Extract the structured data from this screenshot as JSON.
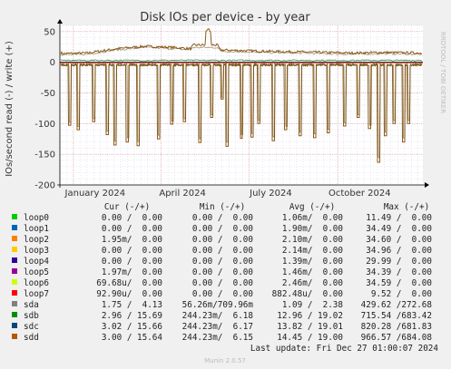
{
  "chart_data": {
    "type": "line",
    "title": "Disk IOs per device - by year",
    "ylabel": "IOs/second read (-) / write (+)",
    "watermark": "RRDTOOL / TOBI OETIKER",
    "ylim": [
      -200,
      60
    ],
    "y_ticks": [
      "50",
      "0",
      "-50",
      "-100",
      "-150",
      "-200"
    ],
    "x_ticks": [
      "January 2024",
      "April 2024",
      "July 2024",
      "October 2024"
    ],
    "grid": true,
    "colors": {
      "background": "#f0f0f0",
      "plot": "#ffffff",
      "major_grid": "#e0a0a0",
      "minor_grid": "#d0d0e8",
      "sdd": "#8c5a18",
      "sdc": "#6a4a10",
      "sda": "#2a7a2a",
      "loop7": "#cc0000"
    },
    "series_note": "sdd/sdc dominate: write ~+15..+30 with spike ~+55; reads near 0 with deep dips to ~-165",
    "sdd_write_profile": [
      {
        "x": "2023-12-20",
        "y": 14
      },
      {
        "x": "2024-01-15",
        "y": 15
      },
      {
        "x": "2024-02-15",
        "y": 22
      },
      {
        "x": "2024-03-15",
        "y": 26
      },
      {
        "x": "2024-04-15",
        "y": 24
      },
      {
        "x": "2024-05-01",
        "y": 22
      },
      {
        "x": "2024-05-20",
        "y": 55
      },
      {
        "x": "2024-06-01",
        "y": 20
      },
      {
        "x": "2024-07-15",
        "y": 18
      },
      {
        "x": "2024-08-15",
        "y": 17
      },
      {
        "x": "2024-09-15",
        "y": 16
      },
      {
        "x": "2024-10-15",
        "y": 15
      },
      {
        "x": "2024-11-15",
        "y": 16
      },
      {
        "x": "2024-12-27",
        "y": 15
      }
    ],
    "sdd_read_dips": [
      {
        "x": "2023-12-28",
        "y": -103
      },
      {
        "x": "2024-01-06",
        "y": -110
      },
      {
        "x": "2024-01-22",
        "y": -97
      },
      {
        "x": "2024-02-05",
        "y": -118
      },
      {
        "x": "2024-02-13",
        "y": -135
      },
      {
        "x": "2024-02-26",
        "y": -130
      },
      {
        "x": "2024-03-08",
        "y": -136
      },
      {
        "x": "2024-03-29",
        "y": -125
      },
      {
        "x": "2024-04-12",
        "y": -101
      },
      {
        "x": "2024-04-25",
        "y": -97
      },
      {
        "x": "2024-05-11",
        "y": -131
      },
      {
        "x": "2024-05-23",
        "y": -90
      },
      {
        "x": "2024-06-03",
        "y": -60
      },
      {
        "x": "2024-06-08",
        "y": -137
      },
      {
        "x": "2024-06-23",
        "y": -124
      },
      {
        "x": "2024-07-04",
        "y": -122
      },
      {
        "x": "2024-07-11",
        "y": -100
      },
      {
        "x": "2024-07-26",
        "y": -128
      },
      {
        "x": "2024-08-08",
        "y": -110
      },
      {
        "x": "2024-08-23",
        "y": -120
      },
      {
        "x": "2024-09-07",
        "y": -123
      },
      {
        "x": "2024-09-21",
        "y": -115
      },
      {
        "x": "2024-10-08",
        "y": -104
      },
      {
        "x": "2024-10-22",
        "y": -90
      },
      {
        "x": "2024-11-03",
        "y": -108
      },
      {
        "x": "2024-11-12",
        "y": -163
      },
      {
        "x": "2024-11-19",
        "y": -120
      },
      {
        "x": "2024-11-28",
        "y": -100
      },
      {
        "x": "2024-12-08",
        "y": -130
      },
      {
        "x": "2024-12-13",
        "y": -100
      }
    ]
  },
  "legend": {
    "headers": [
      "Cur (-/+)",
      "Min (-/+)",
      "Avg (-/+)",
      "Max (-/+)"
    ],
    "rows": [
      {
        "name": "loop0",
        "color": "#00cc00",
        "cur": "0.00 /  0.00",
        "min": "0.00 /  0.00",
        "avg": "1.06m/  0.00",
        "max": "11.49 /  0.00"
      },
      {
        "name": "loop1",
        "color": "#0066b3",
        "cur": "0.00 /  0.00",
        "min": "0.00 /  0.00",
        "avg": "1.90m/  0.00",
        "max": "34.49 /  0.00"
      },
      {
        "name": "loop2",
        "color": "#ff8000",
        "cur": "1.95m/  0.00",
        "min": "0.00 /  0.00",
        "avg": "2.10m/  0.00",
        "max": "34.60 /  0.00"
      },
      {
        "name": "loop3",
        "color": "#ffcc00",
        "cur": "0.00 /  0.00",
        "min": "0.00 /  0.00",
        "avg": "2.14m/  0.00",
        "max": "34.96 /  0.00"
      },
      {
        "name": "loop4",
        "color": "#330099",
        "cur": "0.00 /  0.00",
        "min": "0.00 /  0.00",
        "avg": "1.39m/  0.00",
        "max": "29.99 /  0.00"
      },
      {
        "name": "loop5",
        "color": "#990099",
        "cur": "1.97m/  0.00",
        "min": "0.00 /  0.00",
        "avg": "1.46m/  0.00",
        "max": "34.39 /  0.00"
      },
      {
        "name": "loop6",
        "color": "#ccff00",
        "cur": "69.68u/  0.00",
        "min": "0.00 /  0.00",
        "avg": "2.46m/  0.00",
        "max": "34.59 /  0.00"
      },
      {
        "name": "loop7",
        "color": "#ff0000",
        "cur": "92.90u/  0.00",
        "min": "0.00 /  0.00",
        "avg": "882.48u/  0.00",
        "max": "9.52 /  0.00"
      },
      {
        "name": "sda",
        "color": "#808080",
        "cur": "1.75 /  4.13",
        "min": "56.26m/709.96m",
        "avg": "1.09 /  2.38",
        "max": "429.62 /272.68"
      },
      {
        "name": "sdb",
        "color": "#008f00",
        "cur": "2.96 / 15.69",
        "min": "244.23m/  6.18",
        "avg": "12.96 / 19.02",
        "max": "715.54 /683.42"
      },
      {
        "name": "sdc",
        "color": "#00487d",
        "cur": "3.02 / 15.66",
        "min": "244.23m/  6.17",
        "avg": "13.82 / 19.01",
        "max": "820.28 /681.83"
      },
      {
        "name": "sdd",
        "color": "#b35a00",
        "cur": "3.00 / 15.64",
        "min": "244.23m/  6.15",
        "avg": "14.45 / 19.00",
        "max": "966.57 /684.08"
      }
    ],
    "last_update": "Last update: Fri Dec 27 01:00:07 2024"
  },
  "footer": "Munin 2.0.57"
}
